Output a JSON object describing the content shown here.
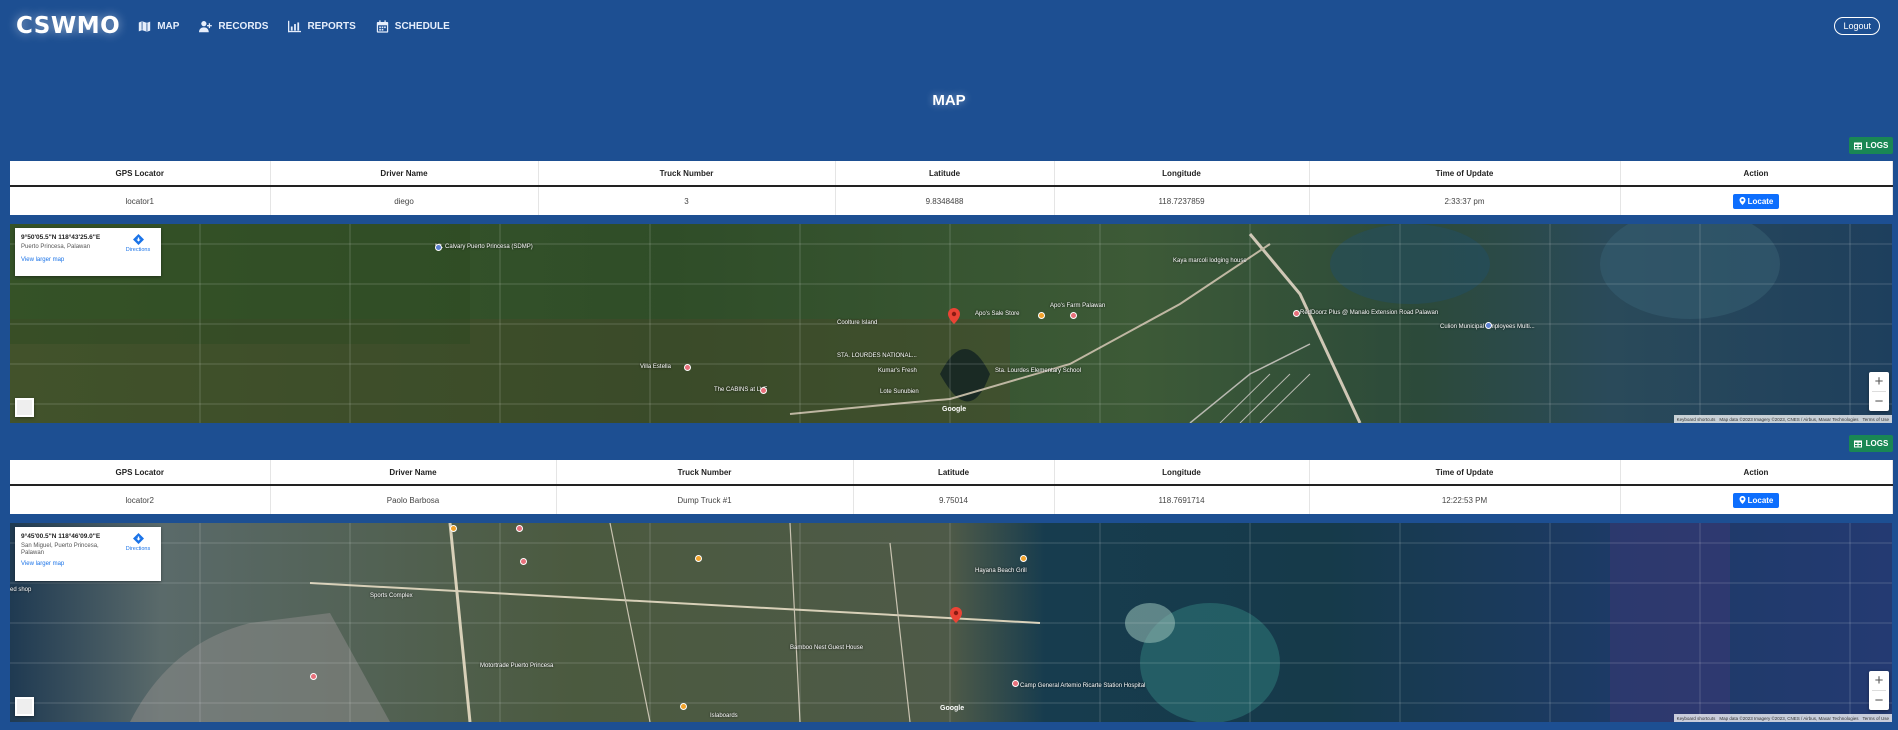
{
  "nav": {
    "brand": "CSWMO",
    "items": [
      {
        "label": "MAP",
        "icon": "map-icon"
      },
      {
        "label": "RECORDS",
        "icon": "user-plus-icon"
      },
      {
        "label": "REPORTS",
        "icon": "chart-icon"
      },
      {
        "label": "SCHEDULE",
        "icon": "calendar-icon"
      }
    ],
    "logout": "Logout"
  },
  "page": {
    "title": "MAP",
    "logs_label": "LOGS"
  },
  "table": {
    "headers": [
      "GPS Locator",
      "Driver Name",
      "Truck Number",
      "Latitude",
      "Longitude",
      "Time of Update",
      "Action"
    ],
    "locate_label": "Locate"
  },
  "locators": [
    {
      "gps": "locator1",
      "driver": "diego",
      "truck": "3",
      "lat": "9.8348488",
      "lng": "118.7237859",
      "time": "2:33:37 pm",
      "map": {
        "coords": "9°50'05.5\"N 118°43'25.6\"E",
        "place": "Puerto Princesa, Palawan",
        "directions": "Directions",
        "larger": "View larger map",
        "labels": [
          {
            "text": "Mt. Calvary Puerto Princesa (SDMP)"
          },
          {
            "text": "Coolture Island"
          },
          {
            "text": "STA. LOURDES NATIONAL..."
          },
          {
            "text": "Kumar's Fresh"
          },
          {
            "text": "Apo's Sale Store"
          },
          {
            "text": "Apo's Farm Palawan"
          },
          {
            "text": "Sta. Lourdes Elementary School"
          },
          {
            "text": "Villa Estella"
          },
          {
            "text": "The CABINS at LVF"
          },
          {
            "text": "Lote Sunubien"
          },
          {
            "text": "Kaya marcoli lodging house"
          },
          {
            "text": "RedDoorz Plus @ Manalo Extension Road Palawan"
          },
          {
            "text": "Culion Municipal Employees Multi..."
          }
        ]
      }
    },
    {
      "gps": "locator2",
      "driver": "Paolo Barbosa",
      "truck": "Dump Truck #1",
      "lat": "9.75014",
      "lng": "118.7691714",
      "time": "12:22:53 PM",
      "map": {
        "coords": "9°45'00.5\"N 118°46'09.0\"E",
        "place": "San Miguel, Puerto Princesa, Palawan",
        "directions": "Directions",
        "larger": "View larger map",
        "labels": [
          {
            "text": "Sports Complex"
          },
          {
            "text": "Motortrade Puerto Princesa"
          },
          {
            "text": "Bamboo Nest Guest House"
          },
          {
            "text": "Hayana Beach Grill"
          },
          {
            "text": "Camp General Artemio Ricarte Station Hospital"
          },
          {
            "text": "Islaboards"
          },
          {
            "text": "ed shop"
          }
        ]
      }
    }
  ],
  "map_ui": {
    "google": "Google",
    "shortcuts": "Keyboard shortcuts",
    "mapdata": "Map data ©2023 Imagery ©2023, CNES / Airbus, Maxar Technologies",
    "terms": "Terms of Use",
    "zoom_in": "+",
    "zoom_out": "−"
  }
}
